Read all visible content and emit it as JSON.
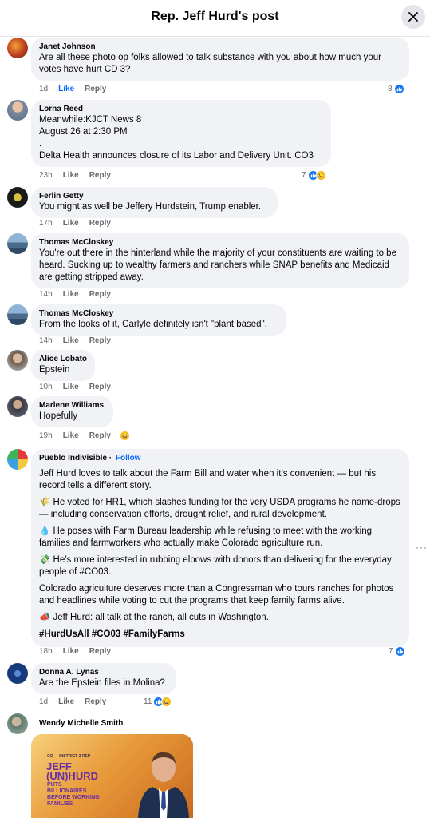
{
  "header": {
    "title": "Rep. Jeff Hurd's post"
  },
  "comments": [
    {
      "name": "Janet Johnson",
      "lines": [
        "Are all these photo op folks allowed to talk substance with you about how much your votes have hurt CD 3?"
      ],
      "time": "1d",
      "like": "Like",
      "reply": "Reply",
      "reaction_count": "8"
    },
    {
      "name": "Lorna Reed",
      "lines": [
        "Meanwhile:KJCT News 8",
        "August 26 at 2:30 PM",
        ".",
        "Delta Health announces closure of its Labor and Delivery Unit. CO3"
      ],
      "time": "23h",
      "like": "Like",
      "reply": "Reply",
      "reaction_count": "7"
    },
    {
      "name": "Ferlin Getty",
      "lines": [
        "You might as well be Jeffery Hurdstein, Trump enabler."
      ],
      "time": "17h",
      "like": "Like",
      "reply": "Reply"
    },
    {
      "name": "Thomas McCloskey",
      "lines": [
        "You're out there in the hinterland while the majority of your constituents are waiting to be heard. Sucking up to wealthy farmers and ranchers while SNAP benefits and Medicaid are getting stripped away."
      ],
      "time": "14h",
      "like": "Like",
      "reply": "Reply"
    },
    {
      "name": "Thomas McCloskey",
      "lines": [
        "From the looks of it, Carlyle definitely isn't \"plant based\"."
      ],
      "time": "14h",
      "like": "Like",
      "reply": "Reply"
    },
    {
      "name": "Alice Lobato",
      "lines": [
        "Epstein"
      ],
      "time": "10h",
      "like": "Like",
      "reply": "Reply"
    },
    {
      "name": "Marlene Williams",
      "lines": [
        "Hopefully"
      ],
      "time": "19h",
      "like": "Like",
      "reply": "Reply"
    },
    {
      "name": "Pueblo Indivisible",
      "follow": "Follow",
      "paragraphs": [
        "Jeff Hurd loves to talk about the Farm Bill and water when it’s convenient — but his record tells a different story.",
        "🌾 He voted for HR1, which slashes funding for the very USDA programs he name-drops — including conservation efforts, drought relief, and rural development.",
        "💧 He poses with Farm Bureau leadership while refusing to meet with the working families and farmworkers who actually make Colorado agriculture run.",
        "💸 He’s more interested in rubbing elbows with donors than delivering for the everyday people of #CO03.",
        "Colorado agriculture deserves more than a Congressman who tours ranches for photos and headlines while voting to cut the programs that keep family farms alive.",
        "📣 Jeff Hurd: all talk at the ranch, all cuts in Washington.",
        "#HurdUsAll #CO03 #FamilyFarms"
      ],
      "time": "18h",
      "like": "Like",
      "reply": "Reply",
      "reaction_count": "7"
    },
    {
      "name": "Donna A. Lynas",
      "lines": [
        "Are the Epstein files in Molina?"
      ],
      "time": "1d",
      "like": "Like",
      "reply": "Reply",
      "reaction_count": "11"
    },
    {
      "name": "Wendy Michelle Smith"
    }
  ],
  "image_card": {
    "tag": "CO — DISTRICT 3 REP",
    "title_line1": "JEFF",
    "title_line2": "(UN)HURD",
    "sub": [
      "PUTS",
      "BILLIONAIRES",
      "BEFORE WORKING",
      "FAMILIES"
    ]
  },
  "icons": [
    "close-icon",
    "like-reaction-icon",
    "sad-reaction-icon",
    "haha-reaction-icon",
    "more-options-icon"
  ],
  "colors": {
    "link": "#0866ff",
    "bubble": "#f0f2f5",
    "meta": "#65676b",
    "like_blue": "#1877f2"
  }
}
